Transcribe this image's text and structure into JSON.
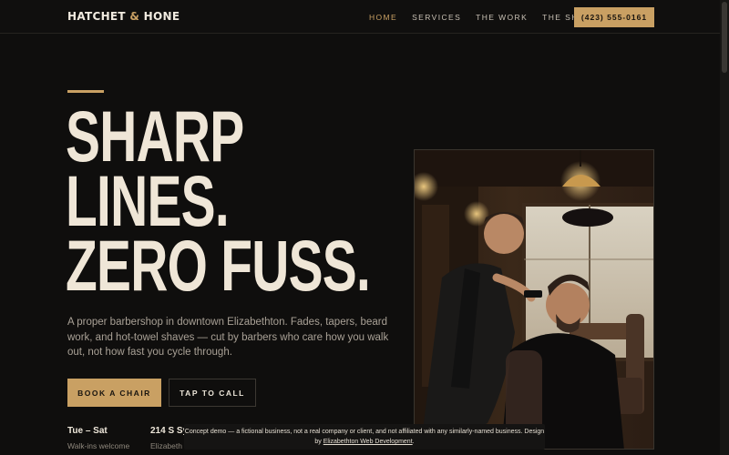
{
  "brand": {
    "name_part1": "HATCHET",
    "ampersand": "&",
    "name_part2": "HONE"
  },
  "nav": {
    "items": [
      {
        "label": "HOME",
        "active": true
      },
      {
        "label": "SERVICES",
        "active": false
      },
      {
        "label": "THE WORK",
        "active": false
      },
      {
        "label": "THE SHOP",
        "active": false
      }
    ],
    "phone": "(423) 555-0161"
  },
  "hero": {
    "headline": [
      "SHARP",
      "LINES.",
      "ZERO FUSS."
    ],
    "lede": "A proper barbershop in downtown Elizabethton. Fades, tapers, beard work, and hot-towel shaves — cut by barbers who care how you walk out, not how fast you cycle through.",
    "book_label": "BOOK A CHAIR",
    "call_label": "TAP TO CALL"
  },
  "info": {
    "hours_title": "Tue – Sat",
    "hours_sub": "Walk-ins welcome",
    "address_title": "214 S Sy",
    "address_sub": "Elizabeth"
  },
  "notice": {
    "text_before": "Concept demo — a fictional business, not a real company or client, and not affiliated with any similarly-named business. Design by ",
    "link": "Elizabethton Web Development",
    "text_after": "."
  },
  "colors": {
    "accent": "#c9a063",
    "background": "#0f0e0d",
    "text": "#efe6d7"
  }
}
